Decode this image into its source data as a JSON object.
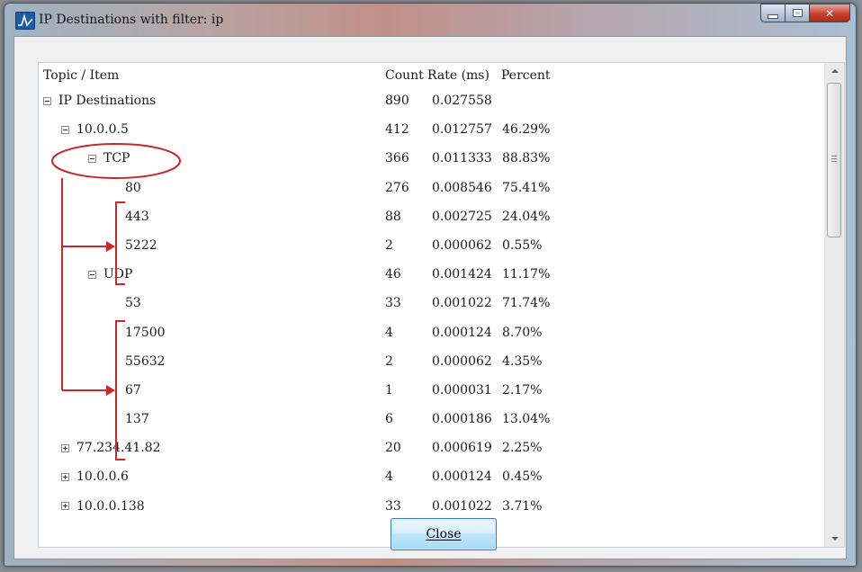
{
  "window": {
    "title": "IP Destinations with filter: ip",
    "icon": "app-waveform-icon"
  },
  "columns": {
    "topic": "Topic / Item",
    "count": "Count",
    "rate": "Rate (ms)",
    "percent": "Percent"
  },
  "rows": [
    {
      "name": "IP Destinations",
      "expander": "minus",
      "count": "890",
      "rate": "0.027558",
      "percent": ""
    },
    {
      "name": "10.0.0.5",
      "expander": "minus",
      "count": "412",
      "rate": "0.012757",
      "percent": "46.29%"
    },
    {
      "name": "TCP",
      "expander": "minus",
      "count": "366",
      "rate": "0.011333",
      "percent": "88.83%"
    },
    {
      "name": "80",
      "expander": "",
      "count": "276",
      "rate": "0.008546",
      "percent": "75.41%"
    },
    {
      "name": "443",
      "expander": "",
      "count": "88",
      "rate": "0.002725",
      "percent": "24.04%"
    },
    {
      "name": "5222",
      "expander": "",
      "count": "2",
      "rate": "0.000062",
      "percent": "0.55%"
    },
    {
      "name": "UDP",
      "expander": "minus",
      "count": "46",
      "rate": "0.001424",
      "percent": "11.17%"
    },
    {
      "name": "53",
      "expander": "",
      "count": "33",
      "rate": "0.001022",
      "percent": "71.74%"
    },
    {
      "name": "17500",
      "expander": "",
      "count": "4",
      "rate": "0.000124",
      "percent": "8.70%"
    },
    {
      "name": "55632",
      "expander": "",
      "count": "2",
      "rate": "0.000062",
      "percent": "4.35%"
    },
    {
      "name": "67",
      "expander": "",
      "count": "1",
      "rate": "0.000031",
      "percent": "2.17%"
    },
    {
      "name": "137",
      "expander": "",
      "count": "6",
      "rate": "0.000186",
      "percent": "13.04%"
    },
    {
      "name": "77.234.41.82",
      "expander": "plus",
      "count": "20",
      "rate": "0.000619",
      "percent": "2.25%"
    },
    {
      "name": "10.0.0.6",
      "expander": "plus",
      "count": "4",
      "rate": "0.000124",
      "percent": "0.45%"
    },
    {
      "name": "10.0.0.138",
      "expander": "plus",
      "count": "33",
      "rate": "0.001022",
      "percent": "3.71%"
    }
  ],
  "buttons": {
    "close": "Close"
  },
  "colors": {
    "annotation": "#c8282a",
    "button_border": "#3c7fb1"
  }
}
